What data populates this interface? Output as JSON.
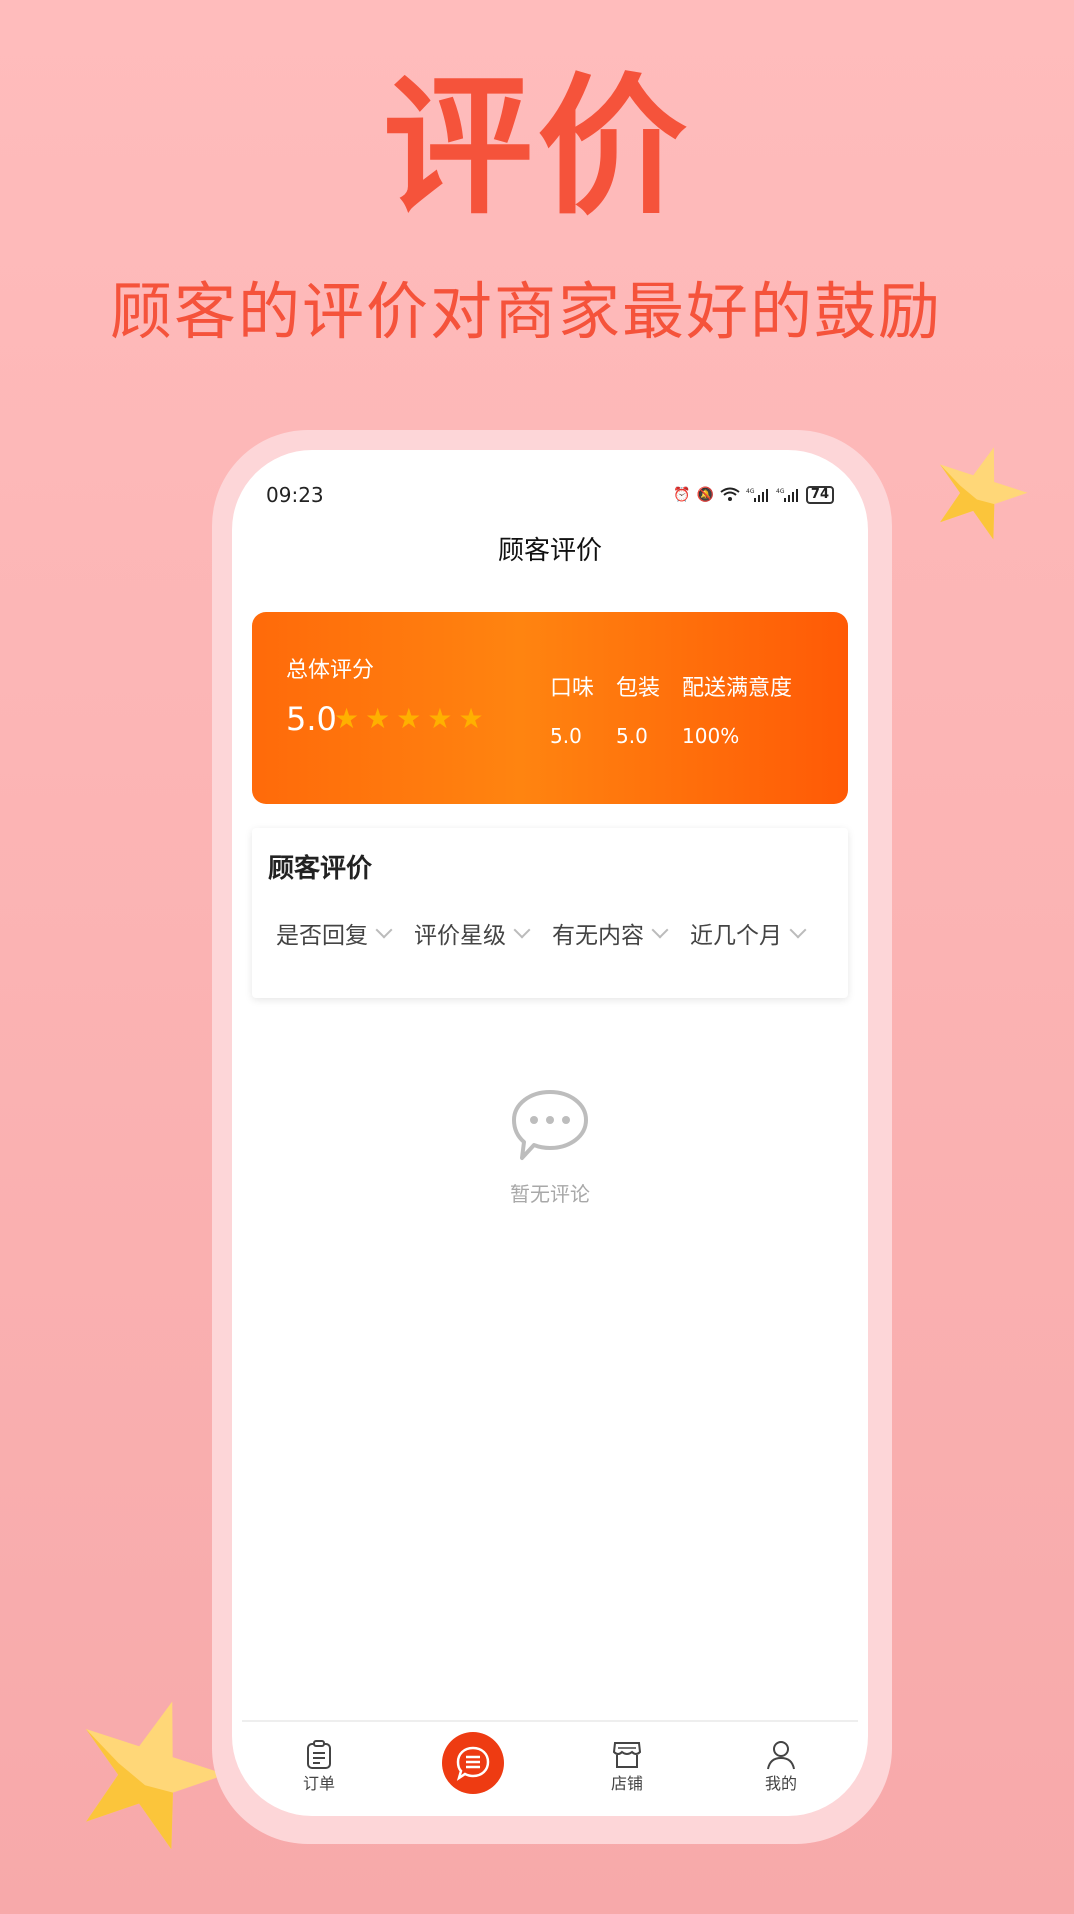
{
  "hero": {
    "title": "评价",
    "subtitle": "顾客的评价对商家最好的鼓励"
  },
  "status_bar": {
    "time": "09:23",
    "icons": [
      "alarm-icon",
      "mute-icon",
      "wifi-icon",
      "signal-4g-icon",
      "signal-4g-icon"
    ],
    "network_label": "4G",
    "battery": "74"
  },
  "page": {
    "title": "顾客评价"
  },
  "score_card": {
    "overall_label": "总体评分",
    "overall_value": "5.0",
    "stars_filled": 5,
    "stars_total": 5,
    "metrics": [
      {
        "label": "口味",
        "value": "5.0"
      },
      {
        "label": "包装",
        "value": "5.0"
      },
      {
        "label": "配送满意度",
        "value": "100%"
      }
    ],
    "colors": {
      "gradient_start": "#ff6a0a",
      "gradient_end": "#ff5a06",
      "star": "#ffb000"
    }
  },
  "reviews": {
    "title": "顾客评价",
    "filters": [
      {
        "label": "是否回复"
      },
      {
        "label": "评价星级"
      },
      {
        "label": "有无内容"
      },
      {
        "label": "近几个月"
      }
    ],
    "empty_text": "暂无评论"
  },
  "tab_bar": {
    "items": [
      {
        "label": "订单",
        "icon": "clipboard-icon"
      },
      {
        "label": "",
        "icon": "chat-icon",
        "active": true
      },
      {
        "label": "店铺",
        "icon": "store-icon"
      },
      {
        "label": "我的",
        "icon": "user-icon"
      }
    ],
    "accent": "#ee3b12"
  },
  "colors": {
    "hero_text": "#f5533b",
    "background": "#ffbcbc"
  }
}
